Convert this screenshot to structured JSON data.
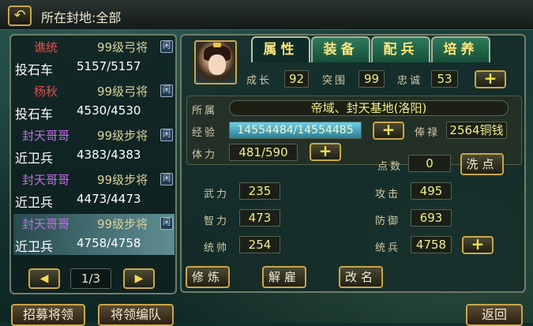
{
  "header": {
    "back_icon": "back-arrow-icon",
    "location": "所在封地:全部"
  },
  "units": [
    {
      "name": "谯统",
      "name_color": "#e05050",
      "level": "99级弓将",
      "badge": "闲",
      "type": "投石车",
      "hp": "5157/5157"
    },
    {
      "name": "杨秋",
      "name_color": "#e05050",
      "level": "99级弓将",
      "badge": "闲",
      "type": "投石车",
      "hp": "4530/4530"
    },
    {
      "name": "封天哥哥",
      "name_color": "#c070e0",
      "level": "99级步将",
      "badge": "闲",
      "type": "近卫兵",
      "hp": "4383/4383"
    },
    {
      "name": "封天哥哥",
      "name_color": "#c070e0",
      "level": "99级步将",
      "badge": "闲",
      "type": "近卫兵",
      "hp": "4473/4473"
    },
    {
      "name": "封天哥哥",
      "name_color": "#c070e0",
      "level": "99级步将",
      "badge": "闲",
      "type": "近卫兵",
      "hp": "4758/4758",
      "selected": true
    }
  ],
  "pager": {
    "prev_icon": "left-arrow-icon",
    "page": "1/3",
    "next_icon": "right-arrow-icon"
  },
  "tabs": [
    {
      "label": "属性",
      "active": true
    },
    {
      "label": "装备"
    },
    {
      "label": "配兵"
    },
    {
      "label": "培养"
    }
  ],
  "top_stats": {
    "growth_label": "成长",
    "growth": "92",
    "breakthrough_label": "突围",
    "breakthrough": "99",
    "loyalty_label": "忠诚",
    "loyalty": "53"
  },
  "info": {
    "fief_label": "所属",
    "fief": "帝域、封天基地(洛阳)",
    "exp_label": "经验",
    "exp": "14554484/14554485",
    "salary_label": "俸禄",
    "salary": "2564铜钱",
    "stamina_label": "体力",
    "stamina": "481/590"
  },
  "points": {
    "label": "点数",
    "value": "0",
    "wash_button": "洗点"
  },
  "attributes": {
    "force_label": "武力",
    "force": "235",
    "intel_label": "智力",
    "intel": "473",
    "command_label": "统帅",
    "command": "254",
    "attack_label": "攻击",
    "attack": "495",
    "defense_label": "防御",
    "defense": "693",
    "troops_label": "统兵",
    "troops": "4758"
  },
  "actions": {
    "train": "修炼",
    "dismiss": "解雇",
    "rename": "改名"
  },
  "bottom": {
    "recruit": "招募将领",
    "formation": "将领编队",
    "back": "返回"
  }
}
